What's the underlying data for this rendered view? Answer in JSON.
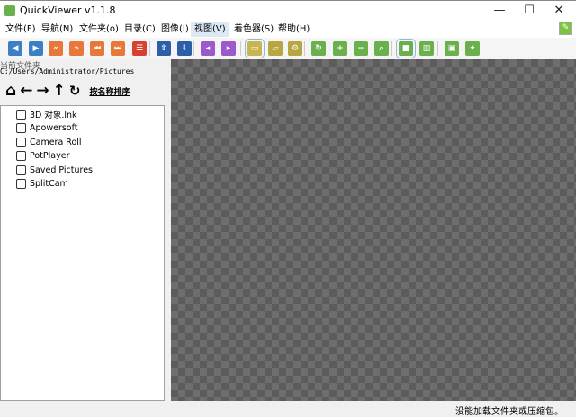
{
  "window": {
    "title": "QuickViewer v1.1.8",
    "minimize": "—",
    "maximize": "☐",
    "close": "✕"
  },
  "menu": [
    "文件(F)",
    "导航(N)",
    "文件夹(o)",
    "目录(C)",
    "图像(I)",
    "视图(V)",
    "着色器(S)",
    "帮助(H)"
  ],
  "toolbar": [
    {
      "name": "prev-page",
      "glyph": "◀",
      "color": "#3b7fc4"
    },
    {
      "name": "next-page",
      "glyph": "▶",
      "color": "#3b7fc4"
    },
    {
      "name": "fast-backward",
      "glyph": "«",
      "color": "#e8773a"
    },
    {
      "name": "fast-forward",
      "glyph": "»",
      "color": "#e8773a"
    },
    {
      "name": "first-page",
      "glyph": "⏮",
      "color": "#e8773a"
    },
    {
      "name": "last-page",
      "glyph": "⏭",
      "color": "#e8773a"
    },
    {
      "name": "page-list",
      "glyph": "☰",
      "color": "#d9412f"
    },
    {
      "name": "prev-folder",
      "glyph": "⇧",
      "color": "#2c5fa8"
    },
    {
      "name": "next-folder",
      "glyph": "⇩",
      "color": "#2c5fa8"
    },
    {
      "name": "prev-volume",
      "glyph": "◂",
      "color": "#9b59c9"
    },
    {
      "name": "next-volume",
      "glyph": "▸",
      "color": "#9b59c9"
    },
    {
      "name": "folder-view",
      "glyph": "▭",
      "color": "#c9b452"
    },
    {
      "name": "catalog",
      "glyph": "▱",
      "color": "#b8a640"
    },
    {
      "name": "settings",
      "glyph": "⚙",
      "color": "#b8a640"
    },
    {
      "name": "rotate",
      "glyph": "↻",
      "color": "#6ab04c"
    },
    {
      "name": "zoom-in",
      "glyph": "+",
      "color": "#6ab04c"
    },
    {
      "name": "zoom-out",
      "glyph": "−",
      "color": "#6ab04c"
    },
    {
      "name": "fit",
      "glyph": "⌕",
      "color": "#6ab04c"
    },
    {
      "name": "single-page",
      "glyph": "■",
      "color": "#6ab04c"
    },
    {
      "name": "dual-page",
      "glyph": "▥",
      "color": "#6ab04c"
    },
    {
      "name": "slideshow",
      "glyph": "▣",
      "color": "#6ab04c"
    },
    {
      "name": "pin",
      "glyph": "✦",
      "color": "#6ab04c"
    }
  ],
  "left": {
    "current_folder_label": "当前文件夹",
    "current_path": "C:/Users/Administrator/Pictures",
    "sort_label": "按名称排序",
    "items": [
      "3D 对象.lnk",
      "Apowersoft",
      "Camera Roll",
      "PotPlayer",
      "Saved Pictures",
      "SplitCam"
    ]
  },
  "status": "没能加载文件夹或压缩包。"
}
